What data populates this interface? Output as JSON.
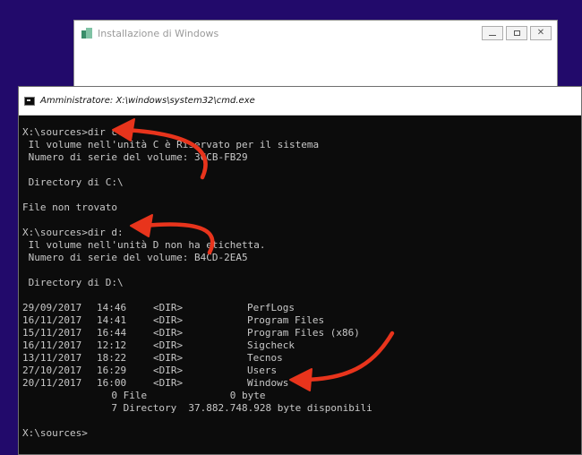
{
  "setup_window": {
    "title": "Installazione di Windows",
    "close_glyph": "✕"
  },
  "cmd_window": {
    "title": "Amministratore: X:\\windows\\system32\\cmd.exe"
  },
  "console": {
    "prompt1": "X:\\sources>dir c:",
    "vol_c_label": " Il volume nell'unità C è Riservato per il sistema",
    "vol_c_serial": " Numero di serie del volume: 3CCB-FB29",
    "dir_c": " Directory di C:\\",
    "not_found": "File non trovato",
    "prompt2": "X:\\sources>dir d:",
    "vol_d_label": " Il volume nell'unità D non ha etichetta.",
    "vol_d_serial": " Numero di serie del volume: B4CD-2EA5",
    "dir_d": " Directory di D:\\",
    "entries": [
      {
        "date": "29/09/2017",
        "time": "14:46",
        "type": "<DIR>",
        "name": "PerfLogs"
      },
      {
        "date": "16/11/2017",
        "time": "14:41",
        "type": "<DIR>",
        "name": "Program Files"
      },
      {
        "date": "15/11/2017",
        "time": "16:44",
        "type": "<DIR>",
        "name": "Program Files (x86)"
      },
      {
        "date": "16/11/2017",
        "time": "12:12",
        "type": "<DIR>",
        "name": "Sigcheck"
      },
      {
        "date": "13/11/2017",
        "time": "18:22",
        "type": "<DIR>",
        "name": "Tecnos"
      },
      {
        "date": "27/10/2017",
        "time": "16:29",
        "type": "<DIR>",
        "name": "Users"
      },
      {
        "date": "20/11/2017",
        "time": "16:00",
        "type": "<DIR>",
        "name": "Windows"
      }
    ],
    "summary_files": "               0 File              0 byte",
    "summary_dirs": "               7 Directory  37.882.748.928 byte disponibili",
    "prompt3": "X:\\sources>"
  },
  "colors": {
    "desktop": "#220a6b",
    "console_bg": "#0c0c0c",
    "console_text": "#c8c8c8",
    "annotation_arrow": "#e8341c"
  }
}
